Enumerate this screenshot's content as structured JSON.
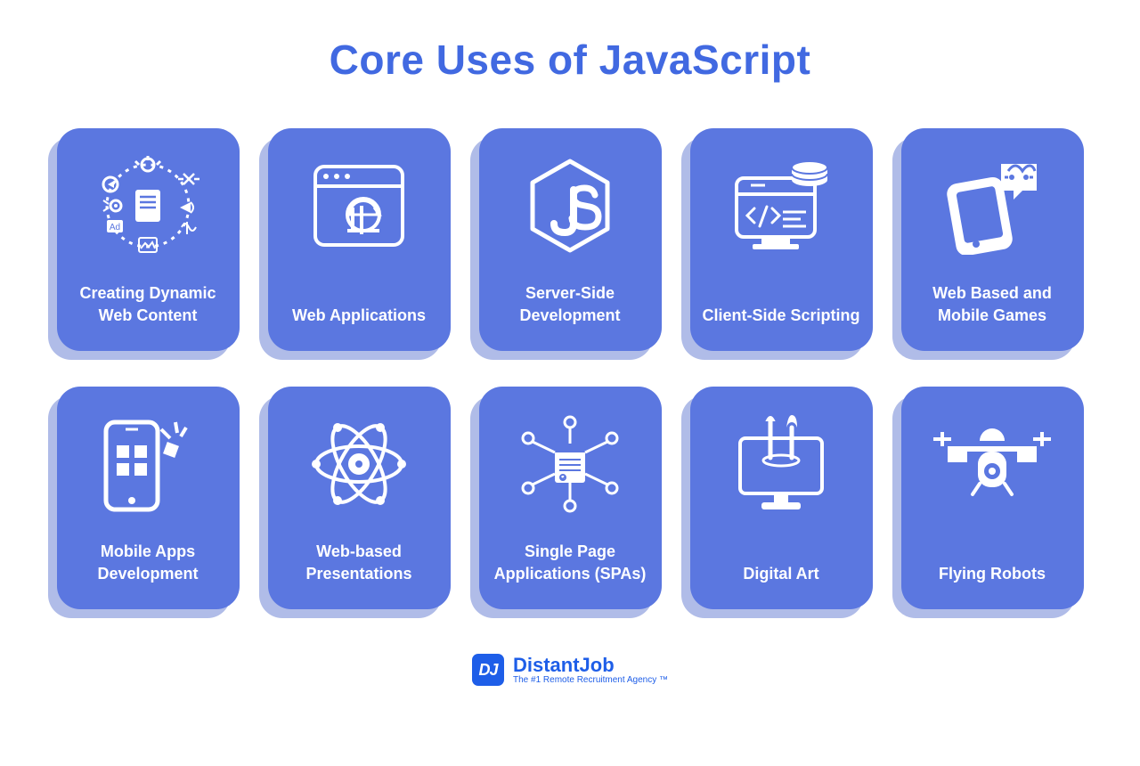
{
  "title": "Core Uses of JavaScript",
  "colors": {
    "accent": "#4169E1",
    "card": "#5B77E0",
    "shadow": "#B0BCE8"
  },
  "cards": [
    {
      "label": "Creating Dynamic Web Content",
      "icon": "dynamic-content-icon"
    },
    {
      "label": "Web Applications",
      "icon": "web-apps-icon"
    },
    {
      "label": "Server-Side Development",
      "icon": "nodejs-icon"
    },
    {
      "label": "Client-Side Scripting",
      "icon": "client-side-icon"
    },
    {
      "label": "Web Based and Mobile Games",
      "icon": "games-icon"
    },
    {
      "label": "Mobile Apps Development",
      "icon": "mobile-apps-icon"
    },
    {
      "label": "Web-based Presentations",
      "icon": "presentations-icon"
    },
    {
      "label": "Single Page Applications (SPAs)",
      "icon": "spa-icon"
    },
    {
      "label": "Digital Art",
      "icon": "digital-art-icon"
    },
    {
      "label": "Flying Robots",
      "icon": "drone-icon"
    }
  ],
  "footer": {
    "logo_text": "DJ",
    "brand": "DistantJob",
    "tagline": "The #1 Remote Recruitment Agency ™"
  }
}
